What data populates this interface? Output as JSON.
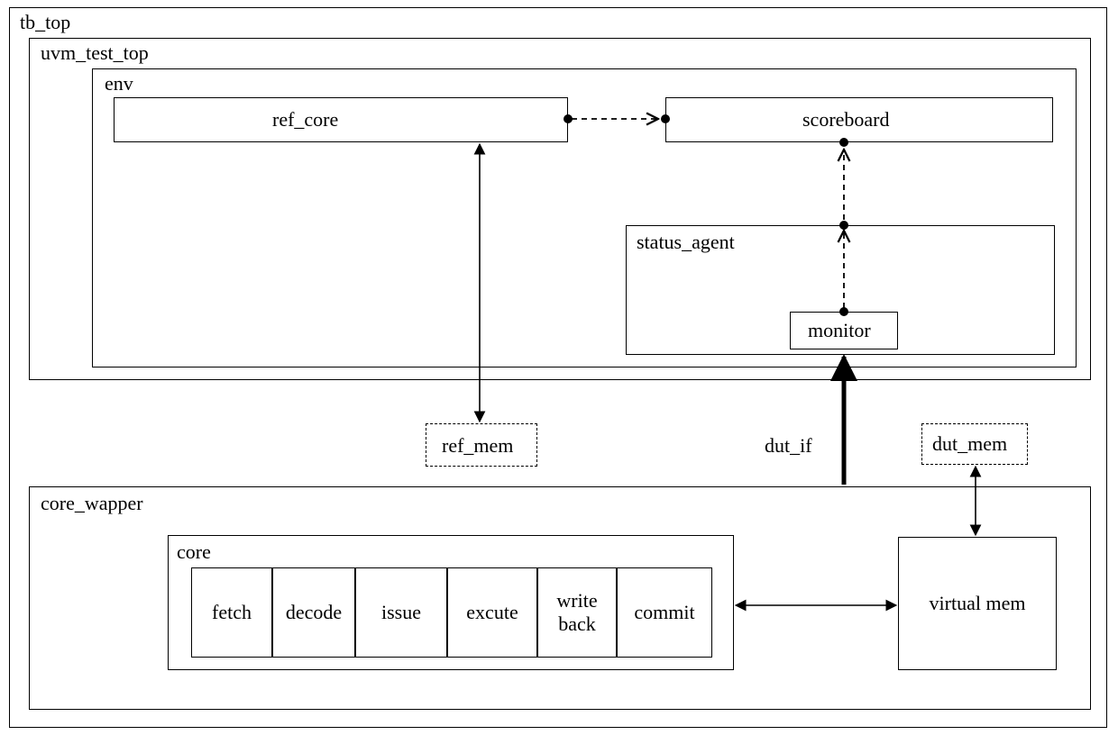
{
  "diagram": {
    "tb_top": "tb_top",
    "uvm_test_top": "uvm_test_top",
    "env": "env",
    "ref_core": "ref_core",
    "scoreboard": "scoreboard",
    "status_agent": "status_agent",
    "monitor": "monitor",
    "ref_mem": "ref_mem",
    "dut_if": "dut_if",
    "dut_mem": "dut_mem",
    "core_wapper": "core_wapper",
    "core": "core",
    "pipeline": {
      "fetch": "fetch",
      "decode": "decode",
      "issue": "issue",
      "excute": "excute",
      "write_back": "write\nback",
      "commit": "commit"
    },
    "virtual_mem": "virtual mem"
  }
}
